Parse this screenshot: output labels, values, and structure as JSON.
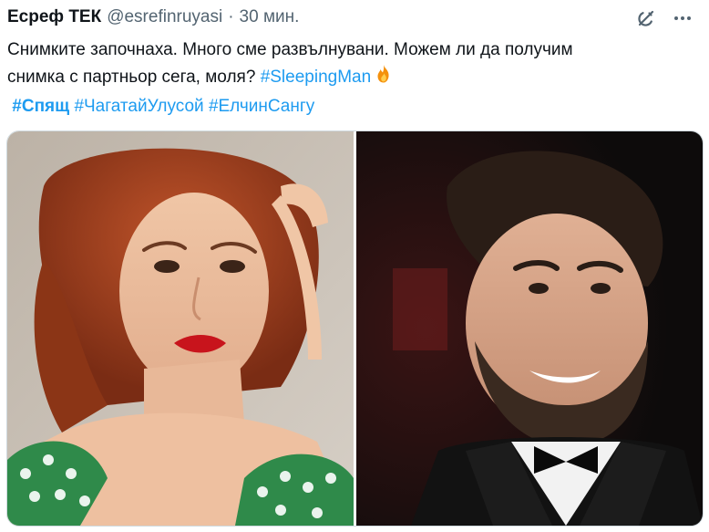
{
  "tweet": {
    "display_name": "Есреф ТЕК",
    "handle": "@esrefinruyasi",
    "separator": "·",
    "time": "30 мин.",
    "text_line1": "Снимките започнаха. Много сме развълнувани. Можем ли да получим",
    "text_line2_prefix": "снимка с партньор сега, моля?",
    "hashtag_sleepingman": "#SleepingMan",
    "hashtag_spyasht": "#Спящ",
    "hashtag_chagatay": "#ЧагатайУлусой",
    "hashtag_elchin": "#ЕлчинСангу"
  },
  "icons": {
    "grok": "grok-icon",
    "more": "more-options-icon",
    "fire": "fire-emoji-icon"
  },
  "colors": {
    "link": "#1d9bf0",
    "secondary_text": "#536471",
    "primary_text": "#0f1419",
    "border": "#cfd9de"
  }
}
